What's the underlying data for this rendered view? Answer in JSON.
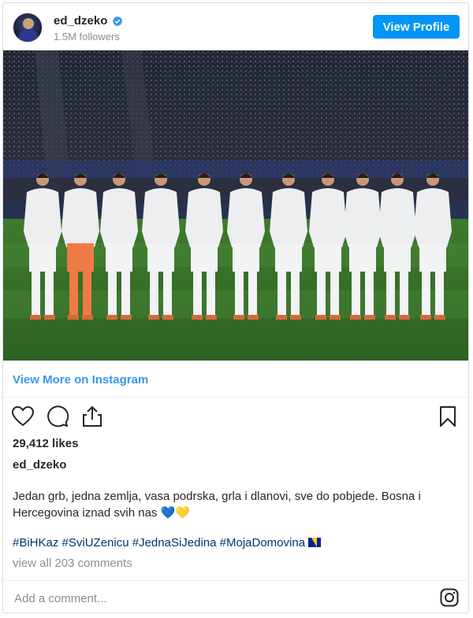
{
  "header": {
    "username": "ed_dzeko",
    "followers": "1.5M followers",
    "view_profile_label": "View Profile",
    "verified_icon": "verified-badge-icon",
    "accent_color": "#0095f6"
  },
  "post": {
    "photo_alt": "Bosnia and Herzegovina national team lined up in white kits before a match",
    "view_more_label": "View More on Instagram",
    "likes": "29,412 likes",
    "author": "ed_dzeko",
    "caption_line1": "Jedan grb, jedna zemlja, vasa podrska, grla i dlanovi, sve do pobjede. Bosna i",
    "caption_line2": "Hercegovina iznad svih nas ",
    "caption_emoji": "💙💛",
    "hashtags": "#BiHKaz #SviUZenicu #JednaSiJedina #MojaDomovina ",
    "view_all_comments": "view all 203 comments"
  },
  "actions": {
    "icons": [
      "heart-icon",
      "comment-icon",
      "share-icon",
      "bookmark-icon"
    ]
  },
  "comment": {
    "placeholder": "Add a comment...",
    "logo_icon": "instagram-icon"
  }
}
